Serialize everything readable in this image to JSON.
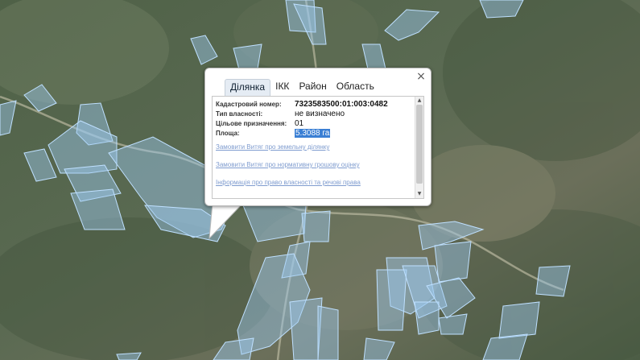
{
  "popup": {
    "tabs": [
      {
        "label": "Ділянка",
        "active": true
      },
      {
        "label": "ІКК",
        "active": false
      },
      {
        "label": "Район",
        "active": false
      },
      {
        "label": "Область",
        "active": false
      }
    ],
    "close_symbol": "×",
    "fields": [
      {
        "label": "Кадастровий номер:",
        "value": "7323583500:01:003:0482"
      },
      {
        "label": "Тип власності:",
        "value": "не визначено"
      },
      {
        "label": "Цільове призначення:",
        "value": "01"
      },
      {
        "label": "Площа:",
        "value": "5.3088 га"
      }
    ],
    "links": [
      "Замовити Витяг про земельну ділянку",
      "Замовити Витяг про нормативну грошову оцінку",
      "Інформація про право власності та речові права"
    ]
  },
  "colors": {
    "parcel_fill": "#9ec9ef",
    "parcel_stroke": "#bfe0ff",
    "link": "#7f9ccf",
    "selection": "#3a7fd4"
  }
}
